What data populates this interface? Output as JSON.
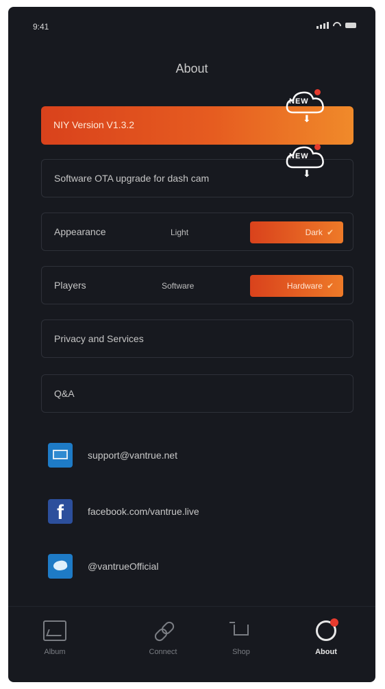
{
  "status_bar": {
    "time": "9:41"
  },
  "header": {
    "title": "About"
  },
  "rows": {
    "version": {
      "label": "NIY Version V1.3.2",
      "badge": "NEW"
    },
    "ota": {
      "label": "Software OTA upgrade for dash cam",
      "badge": "NEW"
    },
    "appearance": {
      "label": "Appearance",
      "option_left": "Light",
      "option_selected": "Dark"
    },
    "players": {
      "label": "Players",
      "option_left": "Software",
      "option_selected": "Hardware"
    },
    "privacy": {
      "label": "Privacy and Services"
    },
    "qa": {
      "label": "Q&A"
    }
  },
  "contacts": [
    {
      "icon": "mail-icon",
      "text": "support@vantrue.net"
    },
    {
      "icon": "facebook-icon",
      "text": "facebook.com/vantrue.live"
    },
    {
      "icon": "twitter-icon",
      "text": "@vantrueOfficial"
    }
  ],
  "tabbar": {
    "items": [
      {
        "label": "Album",
        "icon": "album-icon"
      },
      {
        "label": "Connect",
        "icon": "link-icon"
      },
      {
        "label": "Shop",
        "icon": "cart-icon"
      },
      {
        "label": "About",
        "icon": "about-icon",
        "active": true
      }
    ]
  },
  "colors": {
    "accent": "#e65c20",
    "background": "#17191f",
    "badge": "#e63b2e"
  }
}
